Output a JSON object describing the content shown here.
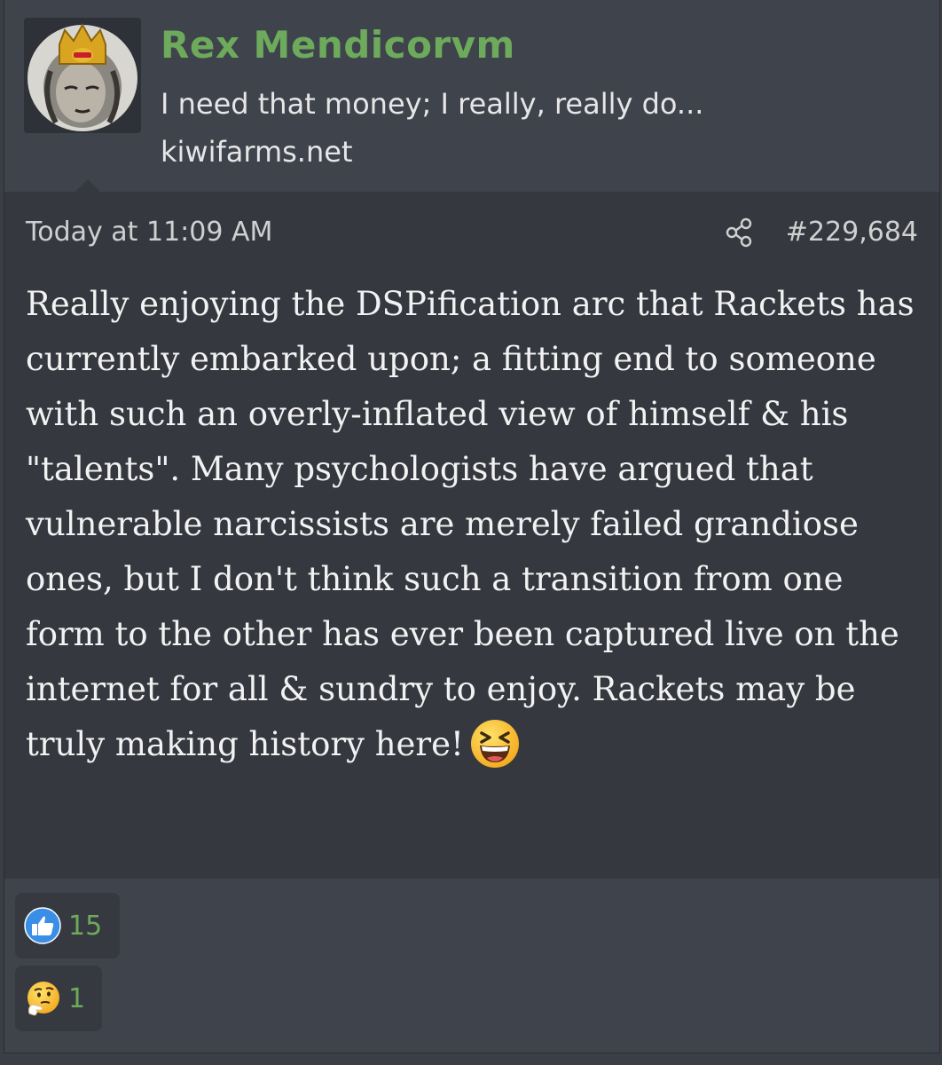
{
  "user": {
    "name": "Rex Mendicorvm",
    "title": "I need that money; I really, really do...",
    "site": "kiwifarms.net",
    "name_color": "#6daa5c"
  },
  "post": {
    "date": "Today at 11:09 AM",
    "number": "#229,684",
    "text": "Really enjoying the DSPification arc that Rackets has currently embarked upon; a fitting end to someone with such an overly-inflated view of himself & his \"talents\". Many psychologists have argued that vulnerable narcissists are merely failed grandiose ones, but I don't think such a transition from one form to the other has ever been captured live on the internet for all & sundry to enjoy. Rackets may be truly making history here!",
    "trailing_emoji": "laughing-emoji"
  },
  "reactions": [
    {
      "icon": "thumbs-up-icon",
      "count": "15"
    },
    {
      "icon": "thinking-emoji-icon",
      "count": "1"
    }
  ]
}
